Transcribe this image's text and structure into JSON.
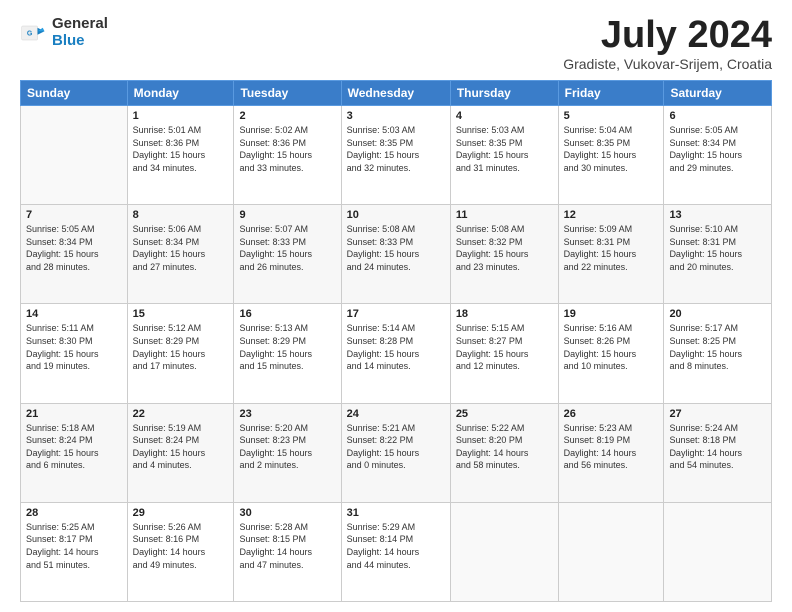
{
  "logo": {
    "general": "General",
    "blue": "Blue"
  },
  "header": {
    "month": "July 2024",
    "location": "Gradiste, Vukovar-Srijem, Croatia"
  },
  "weekdays": [
    "Sunday",
    "Monday",
    "Tuesday",
    "Wednesday",
    "Thursday",
    "Friday",
    "Saturday"
  ],
  "weeks": [
    [
      {
        "day": "",
        "sunrise": "",
        "sunset": "",
        "daylight": ""
      },
      {
        "day": "1",
        "sunrise": "Sunrise: 5:01 AM",
        "sunset": "Sunset: 8:36 PM",
        "daylight": "Daylight: 15 hours and 34 minutes."
      },
      {
        "day": "2",
        "sunrise": "Sunrise: 5:02 AM",
        "sunset": "Sunset: 8:36 PM",
        "daylight": "Daylight: 15 hours and 33 minutes."
      },
      {
        "day": "3",
        "sunrise": "Sunrise: 5:03 AM",
        "sunset": "Sunset: 8:35 PM",
        "daylight": "Daylight: 15 hours and 32 minutes."
      },
      {
        "day": "4",
        "sunrise": "Sunrise: 5:03 AM",
        "sunset": "Sunset: 8:35 PM",
        "daylight": "Daylight: 15 hours and 31 minutes."
      },
      {
        "day": "5",
        "sunrise": "Sunrise: 5:04 AM",
        "sunset": "Sunset: 8:35 PM",
        "daylight": "Daylight: 15 hours and 30 minutes."
      },
      {
        "day": "6",
        "sunrise": "Sunrise: 5:05 AM",
        "sunset": "Sunset: 8:34 PM",
        "daylight": "Daylight: 15 hours and 29 minutes."
      }
    ],
    [
      {
        "day": "7",
        "sunrise": "Sunrise: 5:05 AM",
        "sunset": "Sunset: 8:34 PM",
        "daylight": "Daylight: 15 hours and 28 minutes."
      },
      {
        "day": "8",
        "sunrise": "Sunrise: 5:06 AM",
        "sunset": "Sunset: 8:34 PM",
        "daylight": "Daylight: 15 hours and 27 minutes."
      },
      {
        "day": "9",
        "sunrise": "Sunrise: 5:07 AM",
        "sunset": "Sunset: 8:33 PM",
        "daylight": "Daylight: 15 hours and 26 minutes."
      },
      {
        "day": "10",
        "sunrise": "Sunrise: 5:08 AM",
        "sunset": "Sunset: 8:33 PM",
        "daylight": "Daylight: 15 hours and 24 minutes."
      },
      {
        "day": "11",
        "sunrise": "Sunrise: 5:08 AM",
        "sunset": "Sunset: 8:32 PM",
        "daylight": "Daylight: 15 hours and 23 minutes."
      },
      {
        "day": "12",
        "sunrise": "Sunrise: 5:09 AM",
        "sunset": "Sunset: 8:31 PM",
        "daylight": "Daylight: 15 hours and 22 minutes."
      },
      {
        "day": "13",
        "sunrise": "Sunrise: 5:10 AM",
        "sunset": "Sunset: 8:31 PM",
        "daylight": "Daylight: 15 hours and 20 minutes."
      }
    ],
    [
      {
        "day": "14",
        "sunrise": "Sunrise: 5:11 AM",
        "sunset": "Sunset: 8:30 PM",
        "daylight": "Daylight: 15 hours and 19 minutes."
      },
      {
        "day": "15",
        "sunrise": "Sunrise: 5:12 AM",
        "sunset": "Sunset: 8:29 PM",
        "daylight": "Daylight: 15 hours and 17 minutes."
      },
      {
        "day": "16",
        "sunrise": "Sunrise: 5:13 AM",
        "sunset": "Sunset: 8:29 PM",
        "daylight": "Daylight: 15 hours and 15 minutes."
      },
      {
        "day": "17",
        "sunrise": "Sunrise: 5:14 AM",
        "sunset": "Sunset: 8:28 PM",
        "daylight": "Daylight: 15 hours and 14 minutes."
      },
      {
        "day": "18",
        "sunrise": "Sunrise: 5:15 AM",
        "sunset": "Sunset: 8:27 PM",
        "daylight": "Daylight: 15 hours and 12 minutes."
      },
      {
        "day": "19",
        "sunrise": "Sunrise: 5:16 AM",
        "sunset": "Sunset: 8:26 PM",
        "daylight": "Daylight: 15 hours and 10 minutes."
      },
      {
        "day": "20",
        "sunrise": "Sunrise: 5:17 AM",
        "sunset": "Sunset: 8:25 PM",
        "daylight": "Daylight: 15 hours and 8 minutes."
      }
    ],
    [
      {
        "day": "21",
        "sunrise": "Sunrise: 5:18 AM",
        "sunset": "Sunset: 8:24 PM",
        "daylight": "Daylight: 15 hours and 6 minutes."
      },
      {
        "day": "22",
        "sunrise": "Sunrise: 5:19 AM",
        "sunset": "Sunset: 8:24 PM",
        "daylight": "Daylight: 15 hours and 4 minutes."
      },
      {
        "day": "23",
        "sunrise": "Sunrise: 5:20 AM",
        "sunset": "Sunset: 8:23 PM",
        "daylight": "Daylight: 15 hours and 2 minutes."
      },
      {
        "day": "24",
        "sunrise": "Sunrise: 5:21 AM",
        "sunset": "Sunset: 8:22 PM",
        "daylight": "Daylight: 15 hours and 0 minutes."
      },
      {
        "day": "25",
        "sunrise": "Sunrise: 5:22 AM",
        "sunset": "Sunset: 8:20 PM",
        "daylight": "Daylight: 14 hours and 58 minutes."
      },
      {
        "day": "26",
        "sunrise": "Sunrise: 5:23 AM",
        "sunset": "Sunset: 8:19 PM",
        "daylight": "Daylight: 14 hours and 56 minutes."
      },
      {
        "day": "27",
        "sunrise": "Sunrise: 5:24 AM",
        "sunset": "Sunset: 8:18 PM",
        "daylight": "Daylight: 14 hours and 54 minutes."
      }
    ],
    [
      {
        "day": "28",
        "sunrise": "Sunrise: 5:25 AM",
        "sunset": "Sunset: 8:17 PM",
        "daylight": "Daylight: 14 hours and 51 minutes."
      },
      {
        "day": "29",
        "sunrise": "Sunrise: 5:26 AM",
        "sunset": "Sunset: 8:16 PM",
        "daylight": "Daylight: 14 hours and 49 minutes."
      },
      {
        "day": "30",
        "sunrise": "Sunrise: 5:28 AM",
        "sunset": "Sunset: 8:15 PM",
        "daylight": "Daylight: 14 hours and 47 minutes."
      },
      {
        "day": "31",
        "sunrise": "Sunrise: 5:29 AM",
        "sunset": "Sunset: 8:14 PM",
        "daylight": "Daylight: 14 hours and 44 minutes."
      },
      {
        "day": "",
        "sunrise": "",
        "sunset": "",
        "daylight": ""
      },
      {
        "day": "",
        "sunrise": "",
        "sunset": "",
        "daylight": ""
      },
      {
        "day": "",
        "sunrise": "",
        "sunset": "",
        "daylight": ""
      }
    ]
  ]
}
